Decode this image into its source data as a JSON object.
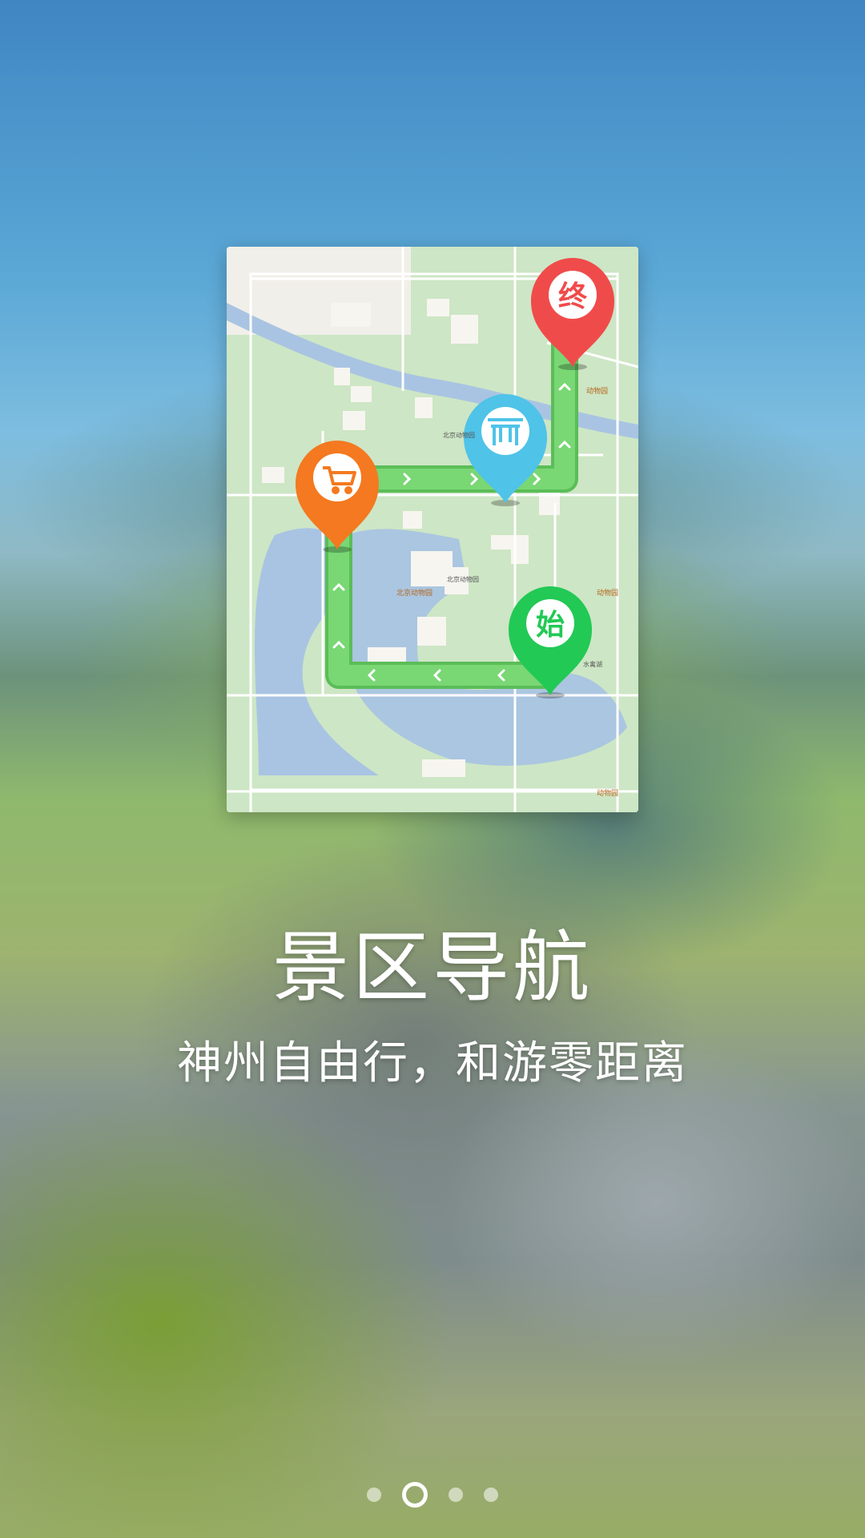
{
  "onboarding": {
    "title": "景区导航",
    "subtitle": "神州自由行，和游零距离",
    "page_index": 2,
    "page_count": 4
  },
  "map": {
    "markers": {
      "end": {
        "label": "终",
        "color": "#f04b4b"
      },
      "start": {
        "label": "始",
        "color": "#22c955"
      },
      "shop": {
        "icon": "shopping-cart-icon",
        "color": "#f47920"
      },
      "gate": {
        "icon": "torii-gate-icon",
        "color": "#4fc3e8"
      }
    },
    "route_color": "#6fcf6b",
    "labels": [
      "动物园",
      "北京动物园",
      "动物园",
      "动物园",
      "北京动物园",
      "北京动物园",
      "水禽湖"
    ]
  }
}
